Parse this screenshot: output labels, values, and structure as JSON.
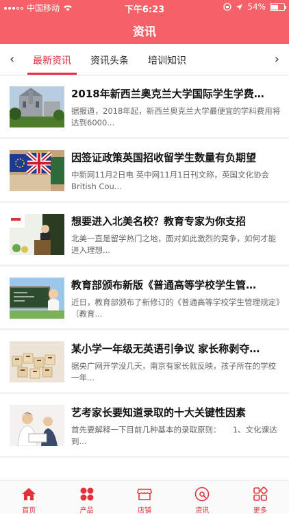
{
  "status_bar": {
    "carrier": "中国移动",
    "time": "下午6:23",
    "battery": "54%",
    "battery_level": 0.54
  },
  "header": {
    "title": "资讯"
  },
  "tabs": {
    "items": [
      {
        "label": "最新资讯",
        "active": true
      },
      {
        "label": "资讯头条",
        "active": false
      },
      {
        "label": "培训知识",
        "active": false
      }
    ],
    "left_arrow": "‹",
    "right_arrow": "›"
  },
  "news": [
    {
      "title": "2018年新西兰奥克兰大学国际学生学费…",
      "desc": "据报道，2018年起，新西兰奥克兰大学最便宜的学科费用将达到6000...",
      "thumb": "university-building"
    },
    {
      "title": "因签证政策英国招收留学生数量有负期望",
      "desc": "中新网11月2日电 英中网11月1日刊文称，英国文化协会British Cou...",
      "thumb": "flags"
    },
    {
      "title": "想要进入北美名校？教育专家为你支招",
      "desc": "北美一直是留学热门之地，面对如此激烈的竞争，如何才能进入理想...",
      "thumb": "speaker"
    },
    {
      "title": "教育部颁布新版《普通高等学校学生管…",
      "desc": "近日，教育部颁布了新修订的《普通高等学校学生管理规定》（教育...",
      "thumb": "student-chalkboard"
    },
    {
      "title": "某小学一年级无英语引争议 家长称剥夺…",
      "desc": "据央广网开学没几天，南京有家长就反映，孩子所在的学校一年...",
      "thumb": "letter-blocks"
    },
    {
      "title": "艺考家长要知道录取的十大关键性因素",
      "desc": "首先要解释一下目前几种基本的录取原则：　　1、文化课达到...",
      "thumb": "parent-child"
    }
  ],
  "bottom_nav": [
    {
      "label": "首页",
      "icon": "home-icon"
    },
    {
      "label": "产品",
      "icon": "product-icon"
    },
    {
      "label": "店铺",
      "icon": "store-icon"
    },
    {
      "label": "资讯",
      "icon": "news-icon"
    },
    {
      "label": "更多",
      "icon": "more-icon"
    }
  ],
  "colors": {
    "brand": "#f46169",
    "accent": "#e2323c"
  }
}
